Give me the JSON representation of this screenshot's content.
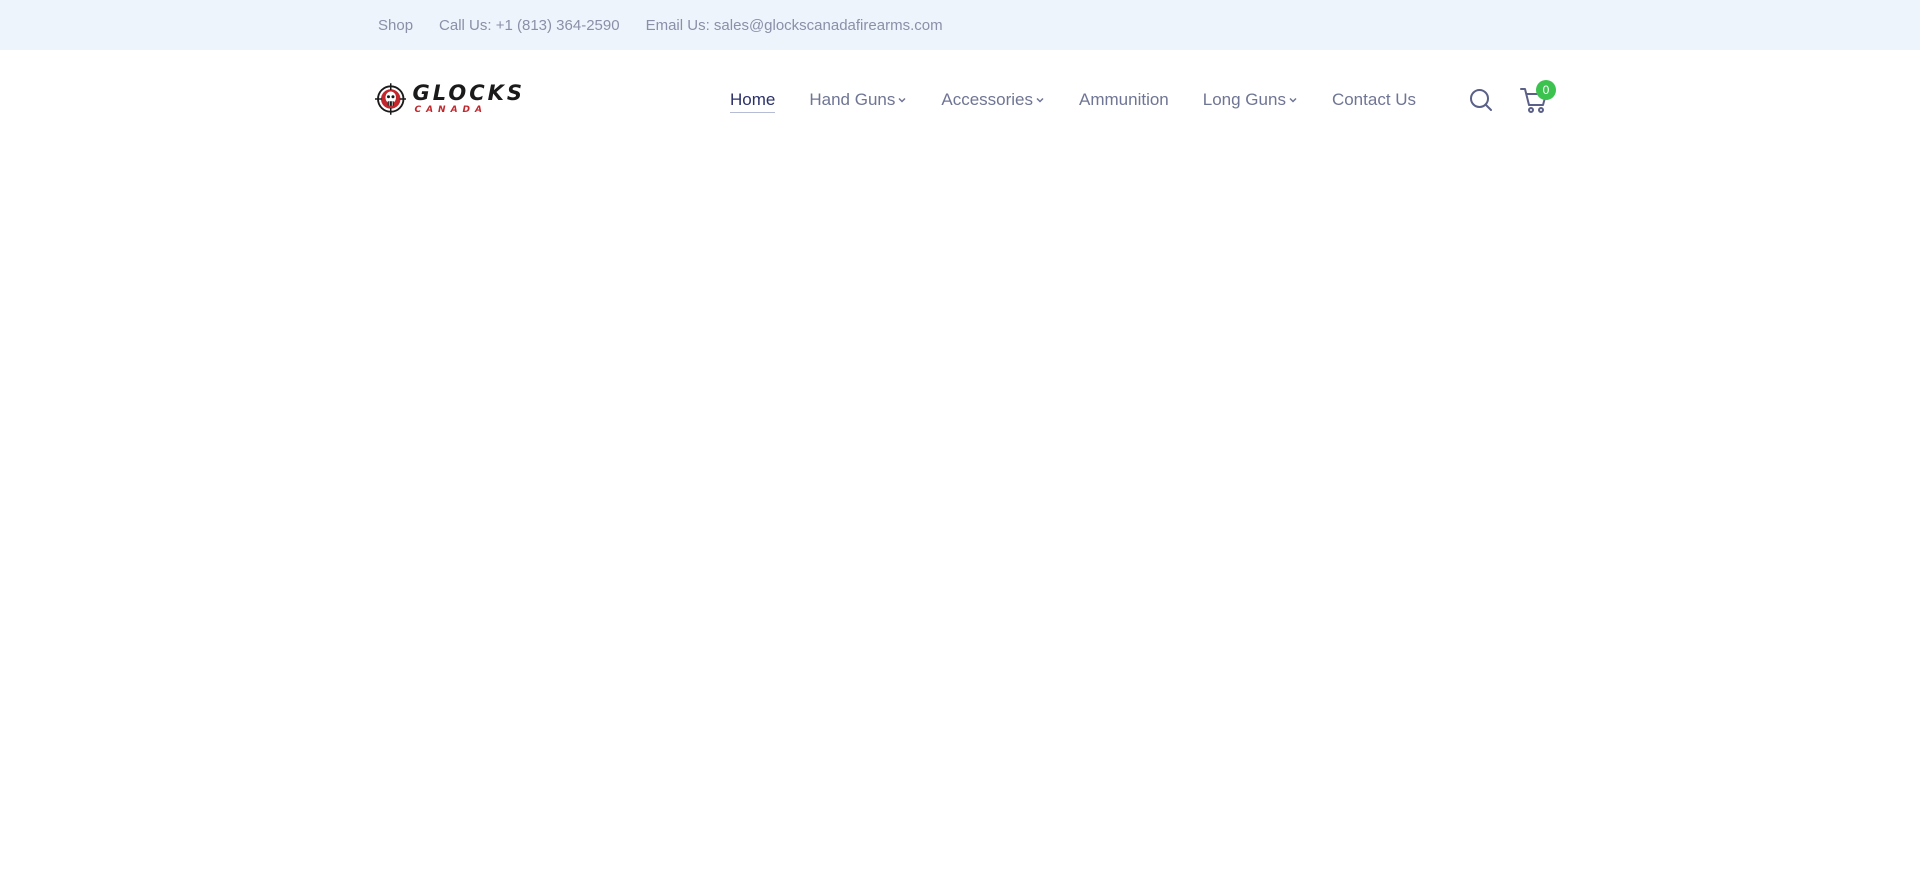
{
  "topbar": {
    "shop_label": "Shop",
    "phone_label": "Call Us: +1 (813) 364-2590",
    "email_label": "Email Us: sales@glockscanadafirearms.com"
  },
  "brand": {
    "logo_main": "GLOCKS",
    "logo_sub": "CANADA",
    "logo_icon": "crosshair-skull-icon"
  },
  "nav": {
    "items": [
      {
        "label": "Home",
        "active": true,
        "has_dropdown": false
      },
      {
        "label": "Hand Guns",
        "active": false,
        "has_dropdown": true
      },
      {
        "label": "Accessories",
        "active": false,
        "has_dropdown": true
      },
      {
        "label": "Ammunition",
        "active": false,
        "has_dropdown": false
      },
      {
        "label": "Long Guns",
        "active": false,
        "has_dropdown": true
      },
      {
        "label": "Contact Us",
        "active": false,
        "has_dropdown": false
      }
    ]
  },
  "header_actions": {
    "search_icon": "search-icon",
    "cart_icon": "cart-icon",
    "cart_count": "0"
  },
  "colors": {
    "topbar_bg": "#eef4fb",
    "nav_text": "#6f7594",
    "nav_active": "#2b3169",
    "badge": "#3cc24f",
    "brand_red": "#c0282d"
  }
}
